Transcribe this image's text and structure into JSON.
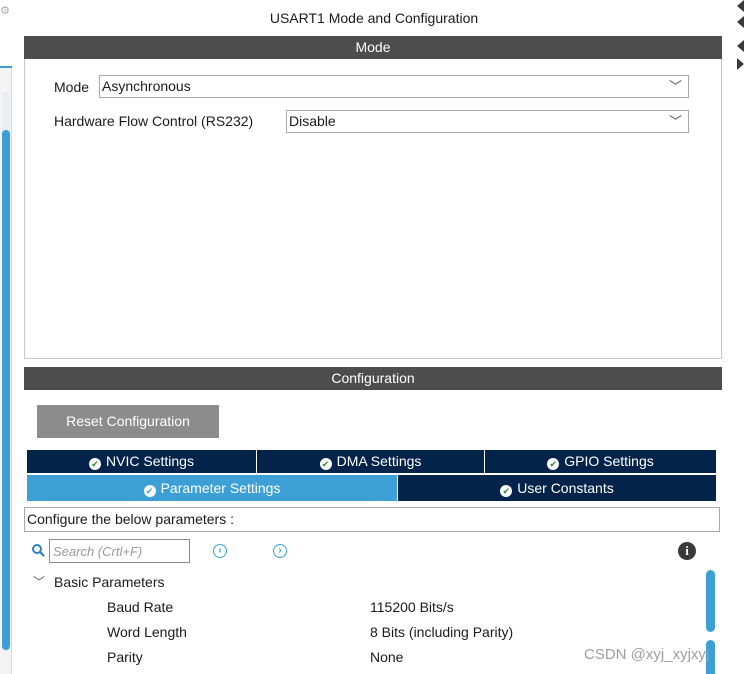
{
  "panel": {
    "title": "USART1 Mode and Configuration"
  },
  "mode_section": {
    "header": "Mode",
    "mode_label": "Mode",
    "mode_value": "Asynchronous",
    "hfc_label": "Hardware Flow Control (RS232)",
    "hfc_value": "Disable"
  },
  "config_section": {
    "header": "Configuration",
    "reset_button": "Reset Configuration",
    "tabs": [
      {
        "label": "NVIC Settings",
        "status": "check"
      },
      {
        "label": "DMA Settings",
        "status": "check"
      },
      {
        "label": "GPIO Settings",
        "status": "check"
      },
      {
        "label": "Parameter Settings",
        "status": "check",
        "selected": true
      },
      {
        "label": "User Constants",
        "status": "check"
      }
    ],
    "hint": "Configure the below parameters :",
    "search": {
      "placeholder": "Search (Crtl+F)"
    },
    "group": {
      "label": "Basic Parameters",
      "expanded": true,
      "params": [
        {
          "name": "Baud Rate",
          "value": "115200 Bits/s"
        },
        {
          "name": "Word Length",
          "value": "8 Bits (including Parity)"
        },
        {
          "name": "Parity",
          "value": "None"
        }
      ]
    }
  },
  "icons": {
    "tab_status": "check-circle-icon",
    "search": "search-icon",
    "prev": "circle-left-icon",
    "next": "circle-right-icon",
    "info": "info-icon",
    "dropdown": "chevron-down-icon"
  },
  "colors": {
    "header_bar": "#4d4d4d",
    "tab_dark": "#03234b",
    "tab_selected": "#3ca0d6",
    "reset_button": "#8c8c8c",
    "accent": "#3ca0d6"
  },
  "watermark": "CSDN @xyj_xyjxyj"
}
